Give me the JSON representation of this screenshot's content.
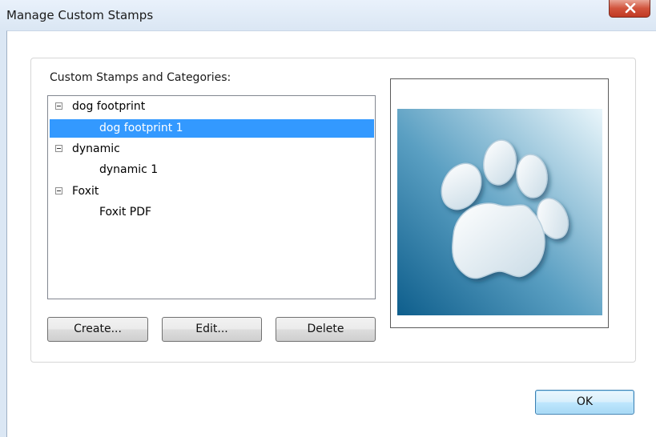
{
  "window": {
    "title": "Manage Custom Stamps"
  },
  "list": {
    "label": "Custom Stamps and Categories:",
    "categories": [
      {
        "name": "dog footprint",
        "items": [
          "dog footprint 1"
        ]
      },
      {
        "name": "dynamic",
        "items": [
          "dynamic 1"
        ]
      },
      {
        "name": "Foxit",
        "items": [
          "Foxit PDF"
        ]
      }
    ],
    "selected_item": "dog footprint 1"
  },
  "buttons": {
    "create": "Create...",
    "edit": "Edit...",
    "delete": "Delete",
    "ok": "OK"
  },
  "preview": {
    "icon": "paw-print-stamp",
    "colors": {
      "dark": "#0e5e8c",
      "light": "#e8f4fa"
    }
  }
}
